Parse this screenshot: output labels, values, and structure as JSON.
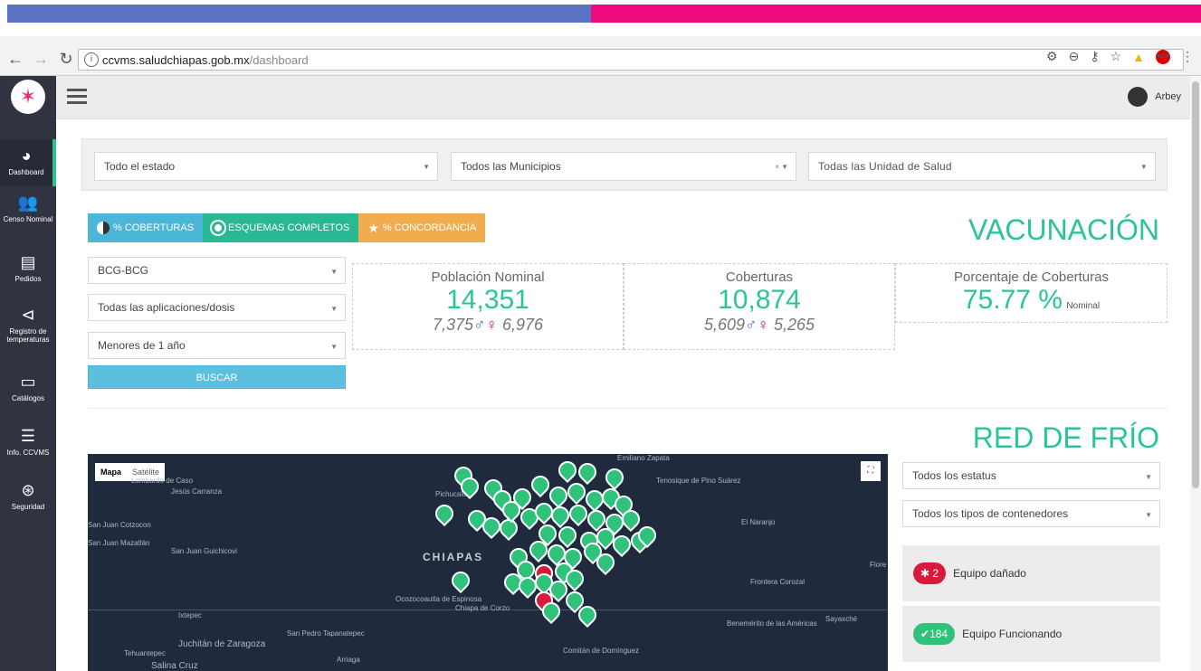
{
  "browser": {
    "url_host": "ccvms.saludchiapas.gob.mx",
    "url_path": "/dashboard",
    "ext_abp": "ABP"
  },
  "sidebar": {
    "items": [
      {
        "label": "Dashboard",
        "icon": "dashboard-icon",
        "glyph": "◕"
      },
      {
        "label": "Censo Nominal",
        "icon": "users-icon",
        "glyph": "👥"
      },
      {
        "label": "Pedidos",
        "icon": "file-icon",
        "glyph": "▤"
      },
      {
        "label": "Registro de temperaturas",
        "icon": "share-icon",
        "glyph": "⊲"
      },
      {
        "label": "Catálogos",
        "icon": "archive-icon",
        "glyph": "▭"
      },
      {
        "label": "Info. CCVMS",
        "icon": "server-icon",
        "glyph": "☰"
      },
      {
        "label": "Seguridad",
        "icon": "accessibility-icon",
        "glyph": "⊛"
      }
    ]
  },
  "header": {
    "user_name": "Arbey"
  },
  "filters": {
    "estado": "Todo el estado",
    "municipios": "Todos las Municipios",
    "unidad": "Todas las Unidad de Salud"
  },
  "vacunacion": {
    "tabs": [
      "% COBERTURAS",
      "ESQUEMAS COMPLETOS",
      "% CONCORDANCIA"
    ],
    "title": "VACUNACIÓN",
    "vaccine": "BCG-BCG",
    "aplicacion": "Todas las aplicaciones/dosis",
    "edad": "Menores de 1 año",
    "buscar": "BUSCAR",
    "poblacion": {
      "label": "Población Nominal",
      "value": "14,351",
      "male": "7,375",
      "female": "6,976"
    },
    "coberturas": {
      "label": "Coberturas",
      "value": "10,874",
      "male": "5,609",
      "female": "5,265"
    },
    "porcentaje": {
      "label": "Porcentaje de Coberturas",
      "value": "75.77 %",
      "suffix": "Nominal"
    }
  },
  "red_frio": {
    "title": "RED DE FRÍO",
    "estatus": "Todos los estatus",
    "contenedores": "Todos los tipos de contenedores",
    "danado": {
      "count": "2",
      "label": "Equipo dañado"
    },
    "funcionando": {
      "count": "184",
      "label": "Equipo Funcionando"
    }
  },
  "map": {
    "type_map": "Mapa",
    "type_sat": "Satélite",
    "region": "CHIAPAS",
    "places": [
      "Jesús Carranza",
      "Lombardo de Caso",
      "Pichucalco",
      "Emiliano Zapata",
      "Tenosique de Pino Suárez",
      "San Juan Cotzocon",
      "San Juan Mazatlán",
      "San Juan Guichicovi",
      "El Naranjo",
      "Frontera Corozal",
      "Ocozocoautla de Espinosa",
      "Chiapa de Corzo",
      "Ixtepec",
      "Juchitán de Zaragoza",
      "Tehuantepec",
      "Salina Cruz",
      "San Pedro Tapanatepec",
      "Arriaga",
      "Comitán de Domínguez",
      "Benemérito de las Américas",
      "Sayaxché",
      "Flore"
    ]
  }
}
